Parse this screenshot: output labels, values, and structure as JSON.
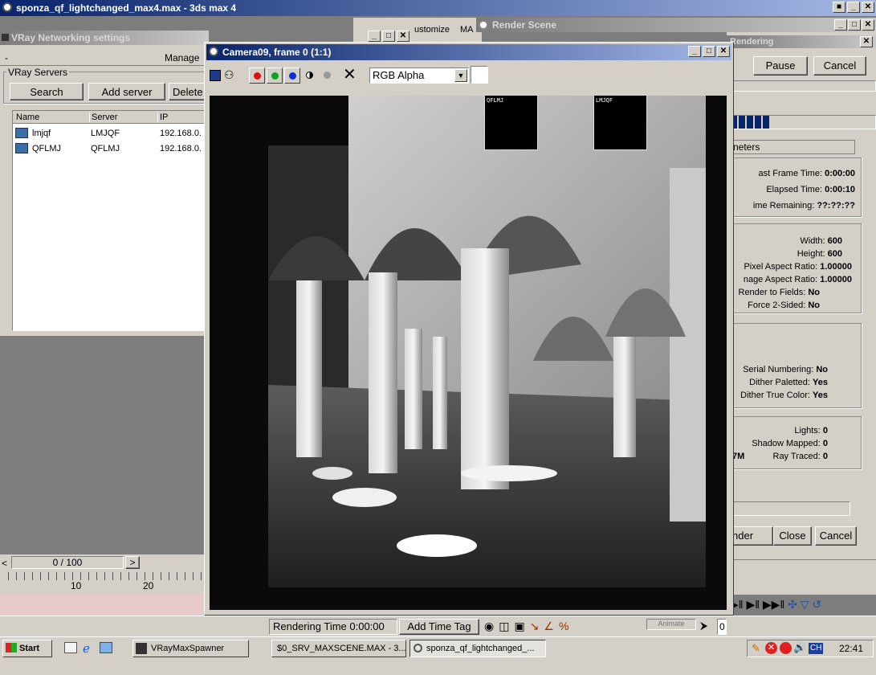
{
  "max_title": "sponza_qf_lightchanged_max4.max - 3ds max 4",
  "vray": {
    "title": "VRay Networking settings",
    "manage_label": "Manage",
    "group_label": "VRay Servers",
    "search_button": "Search",
    "add_server_button": "Add server",
    "delete_button": "Delete",
    "columns": [
      "Name",
      "Server",
      "IP"
    ],
    "servers": [
      {
        "name": "lmjqf",
        "server": "LMJQF",
        "ip": "192.168.0."
      },
      {
        "name": "QFLMJ",
        "server": "QFLMJ",
        "ip": "192.168.0."
      }
    ]
  },
  "behind_labels": {
    "customize": "ustomize",
    "ma": "MA"
  },
  "render_scene_title": "Render Scene",
  "camera": {
    "title": "Camera09, frame 0 (1:1)",
    "channel": "RGB Alpha",
    "bucket_labels": [
      "QFLMJ",
      "LMJQF"
    ]
  },
  "rendering": {
    "title": "Rendering",
    "pause_button": "Pause",
    "cancel_button": "Cancel",
    "progress": 0.28,
    "section_label": "neters",
    "last_frame_label": "ast Frame Time:",
    "last_frame_value": "0:00:00",
    "elapsed_label": "Elapsed Time:",
    "elapsed_value": "0:00:10",
    "remaining_label": "ime Remaining:",
    "remaining_value": "??:??:??",
    "width_label": "Width:",
    "width_value": "600",
    "height_label": "Height:",
    "height_value": "600",
    "pixel_aspect_label": "Pixel Aspect Ratio:",
    "pixel_aspect_value": "1.00000",
    "image_aspect_label": "nage Aspect Ratio:",
    "image_aspect_value": "1.00000",
    "render_fields_label": "Render to Fields:",
    "render_fields_value": "No",
    "force_sided_label": "Force 2-Sided:",
    "force_sided_value": "No",
    "serial_label": "Serial Numbering:",
    "serial_value": "No",
    "dither_pal_label": "Dither Paletted:",
    "dither_pal_value": "Yes",
    "dither_true_label": "Dither True Color:",
    "dither_true_value": "Yes",
    "lights_label": "Lights:",
    "lights_value": "0",
    "shadow_label": "Shadow Mapped:",
    "shadow_value": "0",
    "mem_value": ".7M",
    "raytraced_label": "Ray Traced:",
    "raytraced_value": "0",
    "render_button": "nder",
    "close_button": "Close",
    "cancel2_button": "Cancel"
  },
  "timeline": {
    "frame_counter": "0 / 100",
    "next": ">",
    "tick_10": "10",
    "tick_20": "20"
  },
  "statusbar": {
    "rendering_time": "Rendering Time  0:00:00",
    "add_time_tag": "Add Time Tag",
    "animate": "Animate",
    "frame_field": "0"
  },
  "taskbar": {
    "start": "Start",
    "tasks": [
      "VRayMaxSpawner",
      "$0_SRV_MAXSCENE.MAX - 3...",
      "sponza_qf_lightchanged_..."
    ],
    "lang": "CH",
    "clock": "22:41"
  },
  "colors": {
    "title_active": "#08246b",
    "face": "#d4d0c8",
    "desktop": "#7d7d7d",
    "progress": "#08246b"
  }
}
